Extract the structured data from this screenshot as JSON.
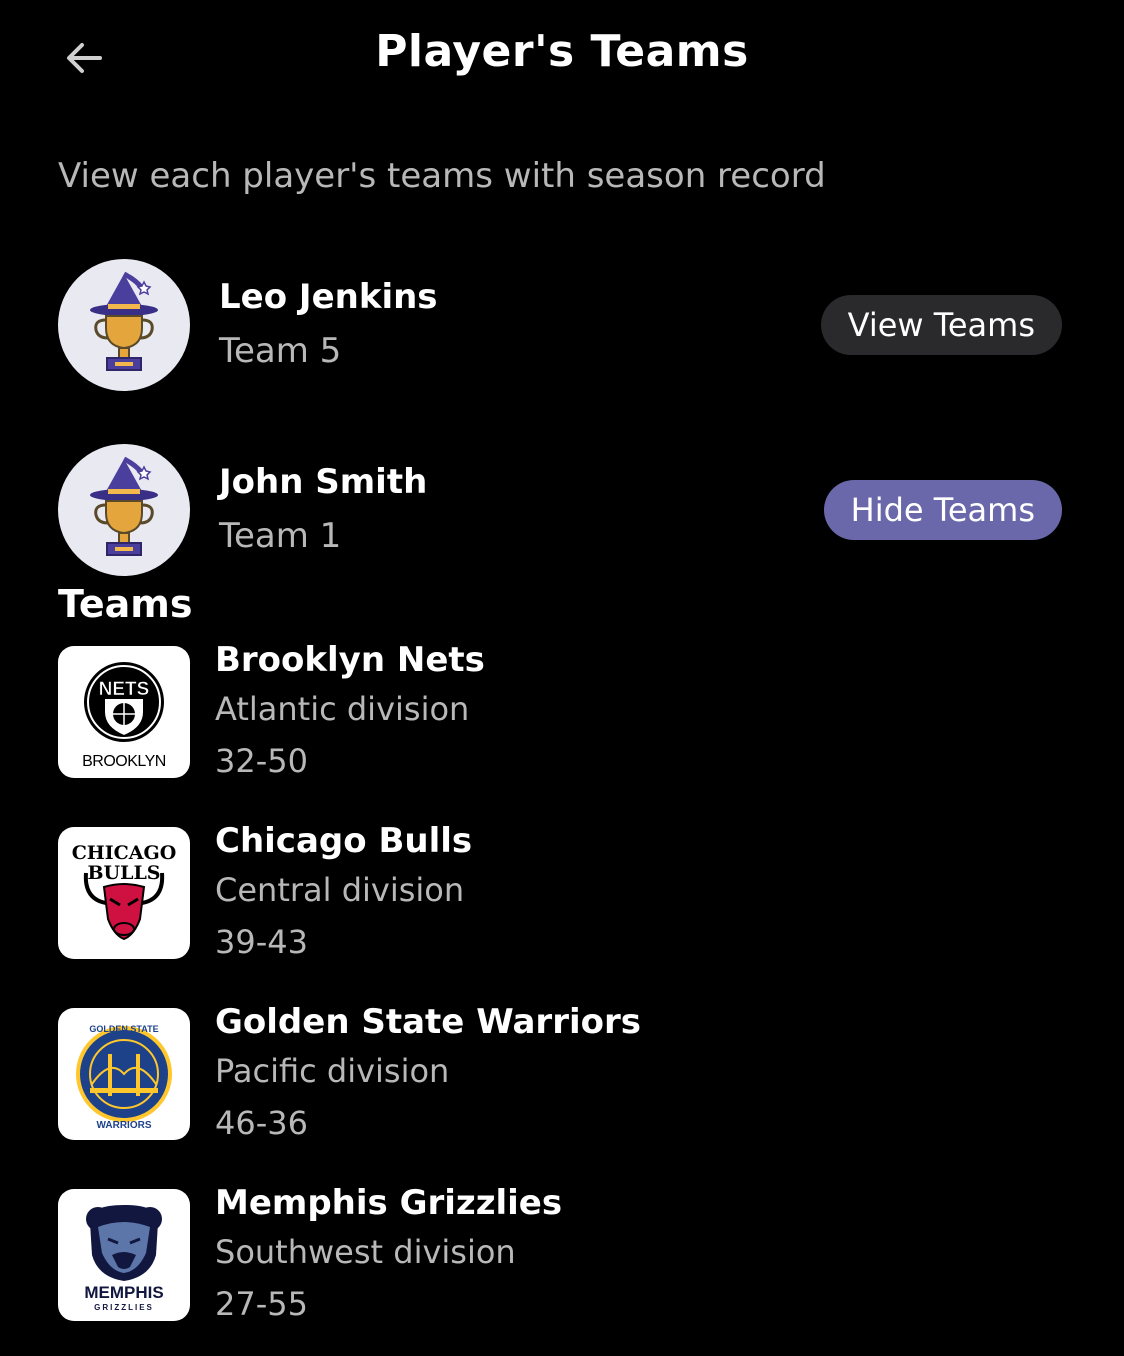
{
  "header": {
    "title": "Player's Teams",
    "back_icon": "arrow-left-icon"
  },
  "subtitle": "View each player's teams with season record",
  "players": [
    {
      "name": "Leo Jenkins",
      "team": "Team 5",
      "button_label": "View Teams",
      "avatar_icon": "wizard-trophy-icon"
    },
    {
      "name": "John Smith",
      "team": "Team 1",
      "button_label": "Hide Teams",
      "avatar_icon": "wizard-trophy-icon"
    }
  ],
  "teams_heading": "Teams",
  "teams": [
    {
      "name": "Brooklyn Nets",
      "division": "Atlantic division",
      "record": "32-50",
      "logo_icon": "brooklyn-nets-logo",
      "logo_text_top": "NETS",
      "logo_text_bottom": "BROOKLYN"
    },
    {
      "name": "Chicago Bulls",
      "division": "Central division",
      "record": "39-43",
      "logo_icon": "chicago-bulls-logo",
      "logo_text_top": "CHICAGO",
      "logo_text_bottom": "BULLS"
    },
    {
      "name": "Golden State Warriors",
      "division": "Pacific division",
      "record": "46-36",
      "logo_icon": "golden-state-warriors-logo",
      "logo_text_top": "GOLDEN STATE",
      "logo_text_bottom": "WARRIORS"
    },
    {
      "name": "Memphis Grizzlies",
      "division": "Southwest division",
      "record": "27-55",
      "logo_icon": "memphis-grizzlies-logo",
      "logo_text_top": "MEMPHIS",
      "logo_text_bottom": "GRIZZLIES"
    }
  ],
  "colors": {
    "background": "#000000",
    "secondary_text": "#b8b8b8",
    "view_button": "#2a2a2d",
    "hide_button": "#6a68aa",
    "avatar_bg": "#e9e9f2"
  }
}
